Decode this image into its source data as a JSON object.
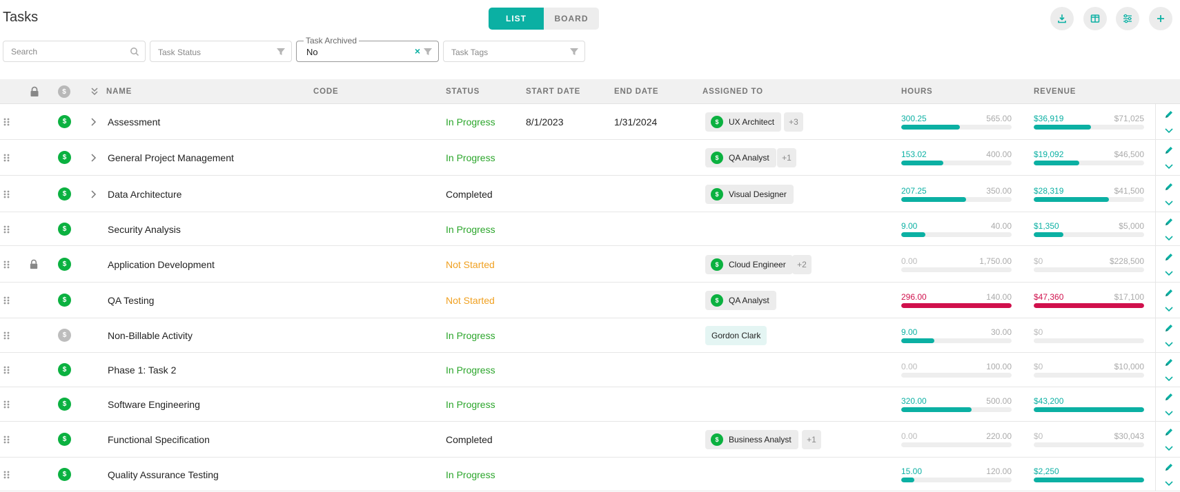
{
  "header": {
    "title": "Tasks"
  },
  "view_toggle": {
    "list": "LIST",
    "board": "BOARD"
  },
  "toolbar": {
    "download_icon": "download-icon",
    "columns_icon": "columns-icon",
    "settings_icon": "sliders-icon",
    "add_icon": "plus-icon"
  },
  "filters": {
    "search_placeholder": "Search",
    "status_placeholder": "Task Status",
    "archived_label": "Task Archived",
    "archived_value": "No",
    "tags_placeholder": "Task Tags"
  },
  "columns": {
    "name": "NAME",
    "code": "CODE",
    "status": "STATUS",
    "start": "START DATE",
    "end": "END DATE",
    "assigned": "ASSIGNED TO",
    "hours": "HOURS",
    "revenue": "REVENUE"
  },
  "colors": {
    "accent": "#0bb0a3",
    "billable": "#0bb140",
    "over_budget": "#d0104c",
    "not_started": "#f0a020",
    "in_progress": "#2aa52a"
  },
  "rows": [
    {
      "name": "Assessment",
      "status": "In Progress",
      "start": "8/1/2023",
      "end": "1/31/2024",
      "assignee": "UX Architect",
      "more": "+3",
      "hours": "300.25",
      "hours_total": "565.00",
      "hours_pct": 53,
      "rev": "$36,919",
      "rev_total": "$71,025",
      "rev_pct": 52
    },
    {
      "name": "General Project Management",
      "status": "In Progress",
      "start": "",
      "end": "",
      "assignee": "QA Analyst",
      "more": "+1",
      "hours": "153.02",
      "hours_total": "400.00",
      "hours_pct": 38,
      "rev": "$19,092",
      "rev_total": "$46,500",
      "rev_pct": 41
    },
    {
      "name": "Data Architecture",
      "status": "Completed",
      "start": "",
      "end": "",
      "assignee": "Visual Designer",
      "more": "",
      "hours": "207.25",
      "hours_total": "350.00",
      "hours_pct": 59,
      "rev": "$28,319",
      "rev_total": "$41,500",
      "rev_pct": 68
    },
    {
      "name": "Security Analysis",
      "status": "In Progress",
      "start": "",
      "end": "",
      "assignee": "",
      "more": "",
      "hours": "9.00",
      "hours_total": "40.00",
      "hours_pct": 22,
      "rev": "$1,350",
      "rev_total": "$5,000",
      "rev_pct": 27
    },
    {
      "name": "Application Development",
      "status": "Not Started",
      "start": "",
      "end": "",
      "assignee": "Cloud Engineer",
      "more": "+2",
      "hours": "0.00",
      "hours_total": "1,750.00",
      "hours_pct": 0,
      "rev": "$0",
      "rev_total": "$228,500",
      "rev_pct": 0
    },
    {
      "name": "QA Testing",
      "status": "Not Started",
      "start": "",
      "end": "",
      "assignee": "QA Analyst",
      "more": "",
      "hours": "296.00",
      "hours_total": "140.00",
      "hours_pct": 100,
      "rev": "$47,360",
      "rev_total": "$17,100",
      "rev_pct": 100
    },
    {
      "name": "Non-Billable Activity",
      "status": "In Progress",
      "start": "",
      "end": "",
      "assignee": "Gordon Clark",
      "more": "",
      "hours": "9.00",
      "hours_total": "30.00",
      "hours_pct": 30,
      "rev": "$0",
      "rev_total": "",
      "rev_pct": 0
    },
    {
      "name": "Phase 1: Task 2",
      "status": "In Progress",
      "start": "",
      "end": "",
      "assignee": "",
      "more": "",
      "hours": "0.00",
      "hours_total": "100.00",
      "hours_pct": 0,
      "rev": "$0",
      "rev_total": "$10,000",
      "rev_pct": 0
    },
    {
      "name": "Software Engineering",
      "status": "In Progress",
      "start": "",
      "end": "",
      "assignee": "",
      "more": "",
      "hours": "320.00",
      "hours_total": "500.00",
      "hours_pct": 64,
      "rev": "$43,200",
      "rev_total": "",
      "rev_pct": 100
    },
    {
      "name": "Functional Specification",
      "status": "Completed",
      "start": "",
      "end": "",
      "assignee": "Business Analyst",
      "more": "+1",
      "hours": "0.00",
      "hours_total": "220.00",
      "hours_pct": 0,
      "rev": "$0",
      "rev_total": "$30,043",
      "rev_pct": 0
    },
    {
      "name": "Quality Assurance Testing",
      "status": "In Progress",
      "start": "",
      "end": "",
      "assignee": "",
      "more": "",
      "hours": "15.00",
      "hours_total": "120.00",
      "hours_pct": 12,
      "rev": "$2,250",
      "rev_total": "",
      "rev_pct": 100
    }
  ]
}
